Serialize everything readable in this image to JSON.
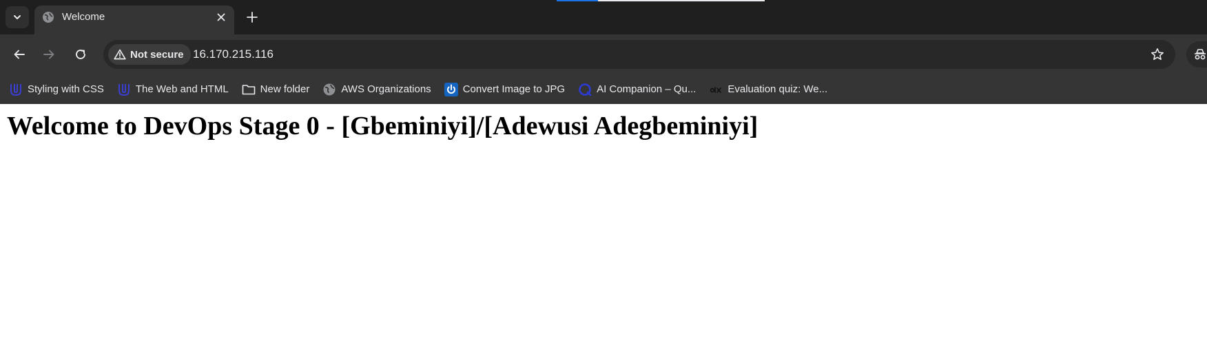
{
  "browser": {
    "tab": {
      "title": "Welcome",
      "favicon": "globe-icon"
    },
    "address_bar": {
      "security_label": "Not secure",
      "url": "16.170.215.116"
    },
    "bookmarks": [
      {
        "label": "Styling with CSS",
        "icon": "udacity-icon"
      },
      {
        "label": "The Web and HTML",
        "icon": "udacity-icon"
      },
      {
        "label": "New folder",
        "icon": "folder-icon"
      },
      {
        "label": "AWS Organizations",
        "icon": "globe-icon"
      },
      {
        "label": "Convert Image to JPG",
        "icon": "power-icon"
      },
      {
        "label": "AI Companion – Qu...",
        "icon": "ai-companion-icon"
      },
      {
        "label": "Evaluation quiz: We...",
        "icon": "alx-icon"
      }
    ],
    "colors": {
      "frame": "#1f1f1f",
      "toolbar": "#353535",
      "omnibox": "#282828",
      "text": "#e8eaed"
    }
  },
  "page": {
    "heading": "Welcome to DevOps Stage 0 - [Gbeminiyi]/[Adewusi Adegbeminiyi]"
  }
}
